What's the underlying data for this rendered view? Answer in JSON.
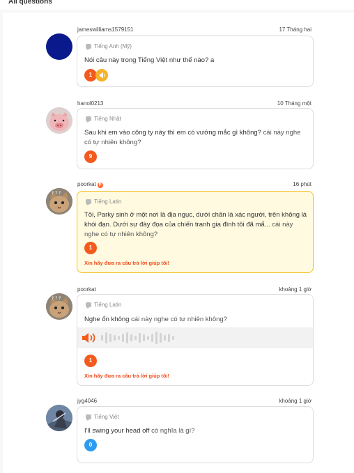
{
  "header": {
    "title": "All questions"
  },
  "questions": [
    {
      "username": "jameswilliams1579151",
      "time": "17 Tháng hai",
      "language": "Tiếng Anh (Mỹ)",
      "text": "Nói câu này trong Tiếng Việt như thế nào? a",
      "answers": "1",
      "avatar_color": "#0a1a8c"
    },
    {
      "username": "hanol0213",
      "time": "10 Tháng một",
      "language": "Tiếng Nhật",
      "text_main": "Sau khi em vào công ty này thì em có vướng mắc gì không?",
      "text_suffix": " cái này nghe có tự nhiên không?",
      "answers": "9"
    },
    {
      "username": "poorkat",
      "badge": "P",
      "time": "16 phút",
      "language": "Tiếng Latin",
      "text_main": "Tôi, Parky sinh ở một nơi là địa ngục, dưới chân là xác người, trên không là khói đạn. Dưới sự đày đọa của chiến tranh gia đình tôi đã mẩ...",
      "text_suffix": " cái này nghe có tự nhiên không?",
      "answers": "1",
      "help": "Xin hãy đưa ra câu trả lời giúp tôi!"
    },
    {
      "username": "poorkat",
      "time": "khoảng 1 giờ",
      "language": "Tiếng Latin",
      "text_main": "Nghe ổn không",
      "text_suffix": " cái này nghe có tự nhiên không?",
      "answers": "1",
      "help": "Xin hãy đưa ra câu trả lời giúp tôi!"
    },
    {
      "username": "jyg4046",
      "time": "khoảng 1 giờ",
      "language": "Tiếng Việt",
      "text_main": "I'll swing your head off",
      "text_suffix": " có nghĩa là gì?",
      "answers": "0"
    }
  ],
  "colors": {
    "accent_orange": "#f25a1e",
    "audio_yellow": "#f7b22a",
    "zero_blue": "#2d9cef",
    "highlight_bg": "#fffae0",
    "highlight_border": "#f0c020"
  },
  "icons": [
    "speech-bubble-icon",
    "speaker-icon",
    "audio-waveform-icon"
  ]
}
